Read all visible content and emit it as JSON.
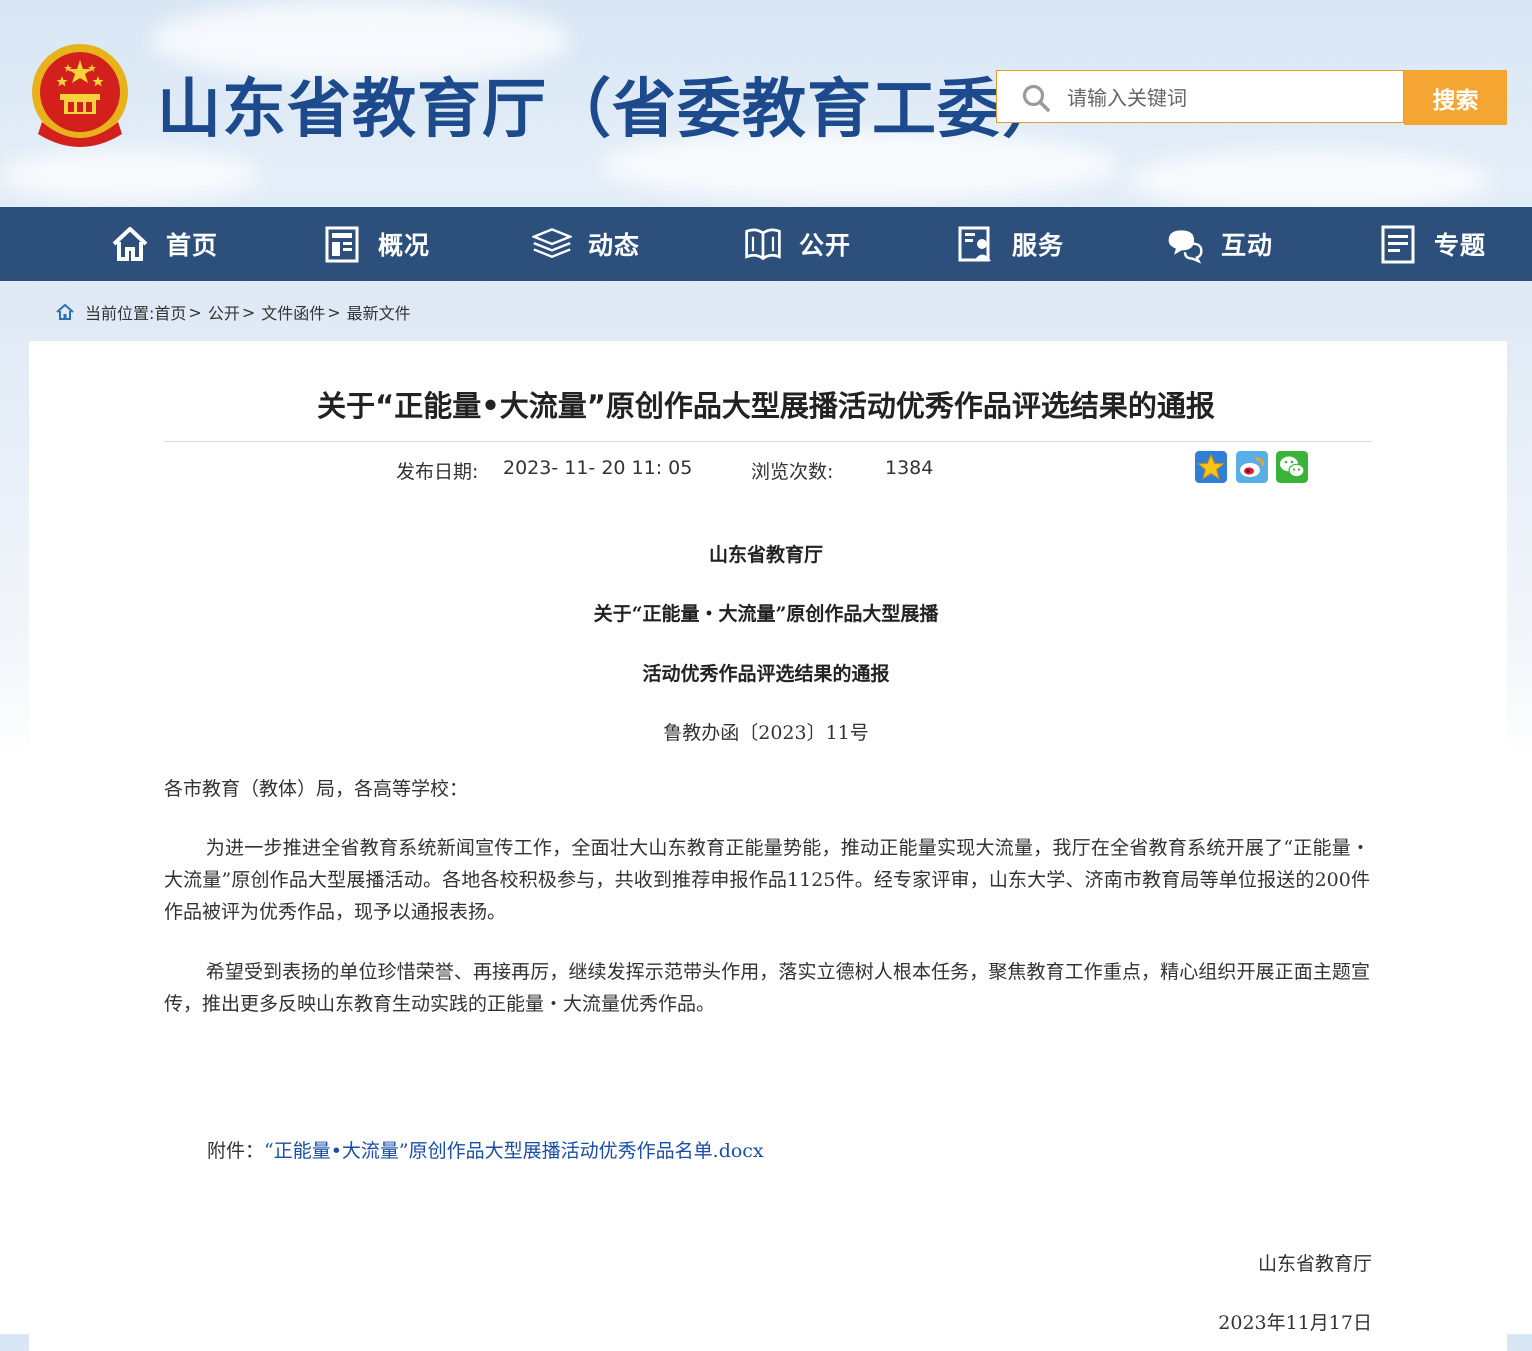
{
  "header": {
    "site_title": "山东省教育厅（省委教育工委）",
    "search_placeholder": "请输入关键词",
    "search_button": "搜索"
  },
  "nav": {
    "items": [
      {
        "label": "首页",
        "icon": "home-icon"
      },
      {
        "label": "概况",
        "icon": "overview-icon"
      },
      {
        "label": "动态",
        "icon": "news-stack-icon"
      },
      {
        "label": "公开",
        "icon": "open-book-icon"
      },
      {
        "label": "服务",
        "icon": "service-icon"
      },
      {
        "label": "互动",
        "icon": "chat-bubbles-icon"
      },
      {
        "label": "专题",
        "icon": "topic-document-icon"
      }
    ]
  },
  "breadcrumb": {
    "prefix": "当前位置:",
    "items": [
      "首页",
      "公开",
      "文件函件",
      "最新文件"
    ],
    "separator": ">"
  },
  "article": {
    "title": "关于“正能量•大流量”原创作品大型展播活动优秀作品评选结果的通报",
    "publish_label": "发布日期:",
    "publish_value": "2023- 11- 20 11: 05",
    "views_label": "浏览次数:",
    "views_value": "1384",
    "share_icons": [
      "favorite-star-icon",
      "weibo-icon",
      "wechat-icon"
    ],
    "doc_issuer": "山东省教育厅",
    "doc_title_line1": "关于“正能量・大流量”原创作品大型展播",
    "doc_title_line2": "活动优秀作品评选结果的通报",
    "doc_number": "鲁教办函〔2023〕11号",
    "salutation": "各市教育（教体）局，各高等学校：",
    "paragraph1": "为进一步推进全省教育系统新闻宣传工作，全面壮大山东教育正能量势能，推动正能量实现大流量，我厅在全省教育系统开展了“正能量・大流量”原创作品大型展播活动。各地各校积极参与，共收到推荐申报作品1125件。经专家评审，山东大学、济南市教育局等单位报送的200件作品被评为优秀作品，现予以通报表扬。",
    "paragraph2": "希望受到表扬的单位珍惜荣誉、再接再厉，继续发挥示范带头作用，落实立德树人根本任务，聚焦教育工作重点，精心组织开展正面主题宣传，推出更多反映山东教育生动实践的正能量・大流量优秀作品。",
    "attachment_label": "附件：",
    "attachment_link": "“正能量•大流量”原创作品大型展播活动优秀作品名单.docx",
    "signature": "山东省教育厅",
    "date": "2023年11月17日"
  },
  "colors": {
    "nav_bg": "#2d4f7c",
    "title_blue": "#1c4a8c",
    "search_orange": "#f5a531",
    "link_blue": "#1a4ea6"
  }
}
